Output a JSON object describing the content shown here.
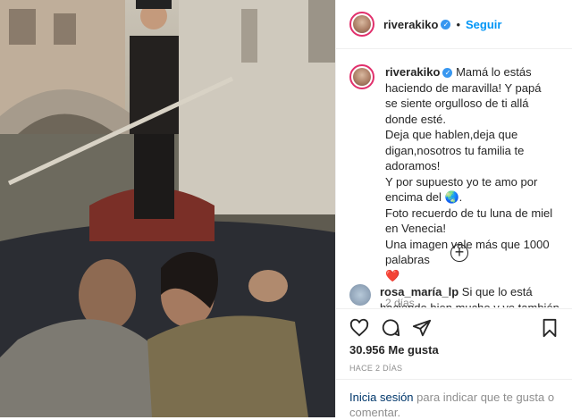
{
  "header": {
    "username": "riverakiko",
    "separator": "•",
    "follow_label": "Seguir"
  },
  "caption": {
    "username": "riverakiko",
    "lines": [
      "Mamá lo estás haciendo de maravilla! Y papá se siente orgulloso de ti allá donde esté.",
      "Deja que hablen,deja que digan,nosotros tu familia te adoramos!",
      "Y por supuesto yo te amo por encima del 🌏.",
      "Foto recuerdo de tu luna de miel en Venecia!",
      "Una imagen vale más que 1000 palabras",
      "❤️"
    ],
    "time": "2 días"
  },
  "comment": {
    "username": "rosa_maría_lp",
    "text": "Si que lo está haciendo bien mucho y yo también le mando mi"
  },
  "stats": {
    "likes": "30.956 Me gusta",
    "posted_ago": "HACE 2 DÍAS"
  },
  "footer": {
    "login_link": "Inicia sesión",
    "rest": " para indicar que te gusta o comentar."
  },
  "icons": {
    "verified": "verified-badge-icon",
    "heart": "heart-icon",
    "comment": "comment-icon",
    "share": "share-icon",
    "bookmark": "bookmark-icon",
    "load_more": "plus-circle-icon"
  },
  "colors": {
    "accent": "#0095f6",
    "verified": "#3897f0",
    "link_dark": "#00376b",
    "muted": "#8e8e8e"
  }
}
